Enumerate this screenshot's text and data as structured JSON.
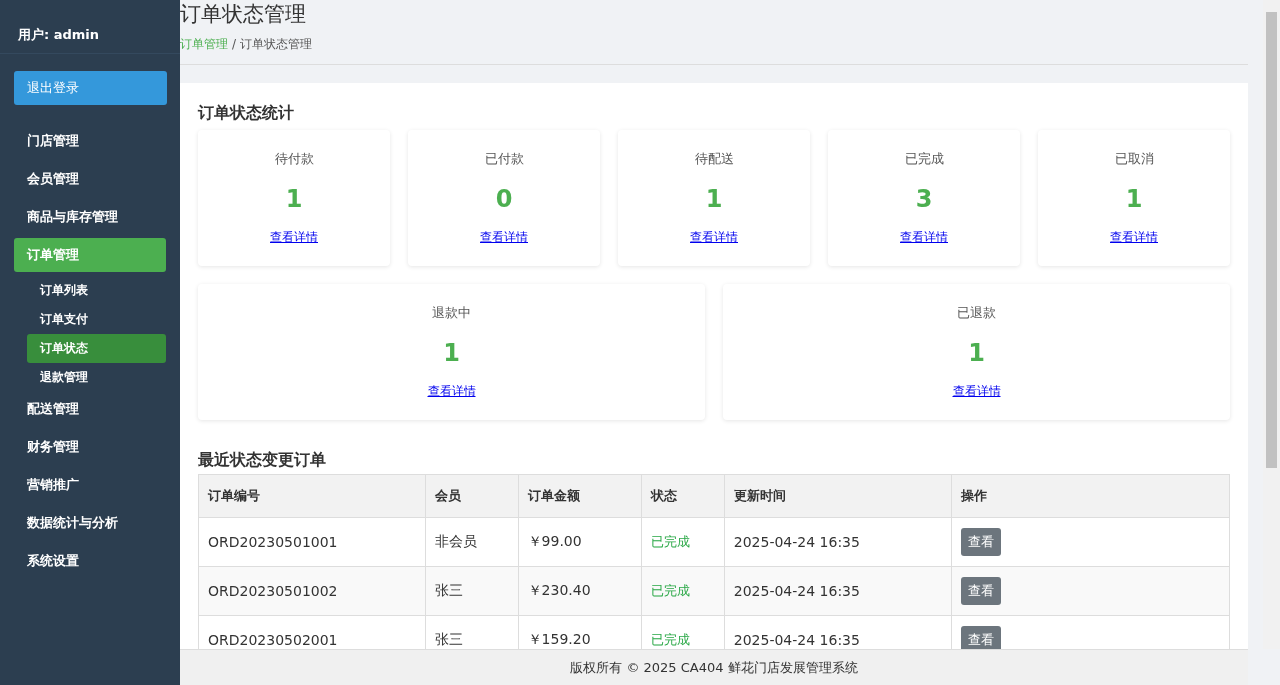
{
  "sidebar": {
    "user": "用户: admin",
    "logout": "退出登录",
    "items": [
      {
        "label": "门店管理",
        "selected": false
      },
      {
        "label": "会员管理",
        "selected": false
      },
      {
        "label": "商品与库存管理",
        "selected": false
      },
      {
        "label": "订单管理",
        "selected": true,
        "children": [
          {
            "label": "订单列表",
            "selected": false
          },
          {
            "label": "订单支付",
            "selected": false
          },
          {
            "label": "订单状态",
            "selected": true
          },
          {
            "label": "退款管理",
            "selected": false
          }
        ]
      },
      {
        "label": "配送管理",
        "selected": false
      },
      {
        "label": "财务管理",
        "selected": false
      },
      {
        "label": "营销推广",
        "selected": false
      },
      {
        "label": "数据统计与分析",
        "selected": false
      },
      {
        "label": "系统设置",
        "selected": false
      }
    ]
  },
  "header": {
    "title": "订单状态管理",
    "breadcrumb": [
      "订单管理",
      "订单状态管理"
    ],
    "separator": "/"
  },
  "stats": {
    "title": "订单状态统计",
    "cards": [
      {
        "label": "待付款",
        "count": "1",
        "link": "查看详情"
      },
      {
        "label": "已付款",
        "count": "0",
        "link": "查看详情"
      },
      {
        "label": "待配送",
        "count": "1",
        "link": "查看详情"
      },
      {
        "label": "已完成",
        "count": "3",
        "link": "查看详情"
      },
      {
        "label": "已取消",
        "count": "1",
        "link": "查看详情"
      },
      {
        "label": "退款中",
        "count": "1",
        "link": "查看详情"
      },
      {
        "label": "已退款",
        "count": "1",
        "link": "查看详情"
      }
    ]
  },
  "recent": {
    "title": "最近状态变更订单",
    "columns": [
      "订单编号",
      "会员",
      "订单金额",
      "状态",
      "更新时间",
      "操作"
    ],
    "rows": [
      {
        "id": "ORD20230501001",
        "member": "非会员",
        "amount": "￥99.00",
        "status": "已完成",
        "time": "2025-04-24 16:35",
        "action": "查看"
      },
      {
        "id": "ORD20230501002",
        "member": "张三",
        "amount": "￥230.40",
        "status": "已完成",
        "time": "2025-04-24 16:35",
        "action": "查看"
      },
      {
        "id": "ORD20230502001",
        "member": "张三",
        "amount": "￥159.20",
        "status": "已完成",
        "time": "2025-04-24 16:35",
        "action": "查看"
      }
    ]
  },
  "footer": "版权所有 © 2025 CA404 鲜花门店发展管理系统"
}
